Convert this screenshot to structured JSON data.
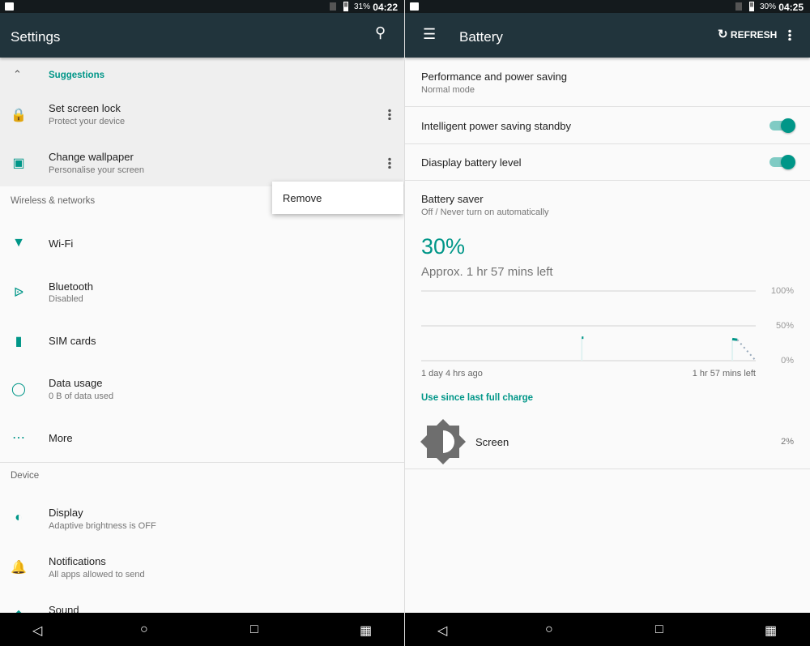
{
  "left": {
    "status": {
      "battery": "31%",
      "time": "04:22"
    },
    "title": "Settings",
    "suggestions_label": "Suggestions",
    "suggestions": [
      {
        "title": "Set screen lock",
        "subtitle": "Protect your device",
        "icon": "lock-icon"
      },
      {
        "title": "Change wallpaper",
        "subtitle": "Personalise your screen",
        "icon": "wallpaper-icon"
      }
    ],
    "popup": {
      "remove": "Remove"
    },
    "sections": [
      {
        "header": "Wireless & networks",
        "items": [
          {
            "title": "Wi-Fi",
            "icon": "wifi-icon"
          },
          {
            "title": "Bluetooth",
            "subtitle": "Disabled",
            "icon": "bluetooth-icon"
          },
          {
            "title": "SIM cards",
            "icon": "sim-card-icon"
          },
          {
            "title": "Data usage",
            "subtitle": "0 B of data used",
            "icon": "data-usage-icon"
          },
          {
            "title": "More",
            "icon": "more-icon"
          }
        ]
      },
      {
        "header": "Device",
        "items": [
          {
            "title": "Display",
            "subtitle": "Adaptive brightness is OFF",
            "icon": "brightness-icon"
          },
          {
            "title": "Notifications",
            "subtitle": "All apps allowed to send",
            "icon": "bell-icon"
          },
          {
            "title": "Sound",
            "icon": "sound-icon"
          }
        ]
      }
    ]
  },
  "right": {
    "status": {
      "battery": "30%",
      "time": "04:25"
    },
    "title": "Battery",
    "refresh": "REFRESH",
    "items": [
      {
        "title": "Performance and power saving",
        "subtitle": "Normal mode"
      },
      {
        "title": "Intelligent power saving standby",
        "toggle": true
      },
      {
        "title": "Diasplay battery level",
        "toggle": true
      },
      {
        "title": "Battery saver",
        "subtitle": "Off / Never turn on automatically"
      }
    ],
    "level": "30%",
    "remaining": "Approx. 1 hr 57 mins left",
    "usage_header": "Use since last full charge",
    "usage": [
      {
        "name": "Screen",
        "percent": "2%",
        "icon": "brightness-icon"
      }
    ],
    "accent": "#009688"
  },
  "chart_data": {
    "type": "line",
    "yticks": [
      "100%",
      "50%",
      "0%"
    ],
    "ylim": [
      0,
      100
    ],
    "xlabels": [
      "1 day 4 hrs ago",
      "1 hr 57 mins left"
    ],
    "series": [
      {
        "points": [
          [
            0.48,
            33
          ],
          [
            0.485,
            33
          ]
        ],
        "style": "solid"
      },
      {
        "points": [
          [
            0.93,
            31
          ],
          [
            0.945,
            30
          ]
        ],
        "style": "solid"
      },
      {
        "points": [
          [
            0.945,
            30
          ],
          [
            1.0,
            0
          ]
        ],
        "style": "dotted"
      }
    ]
  }
}
